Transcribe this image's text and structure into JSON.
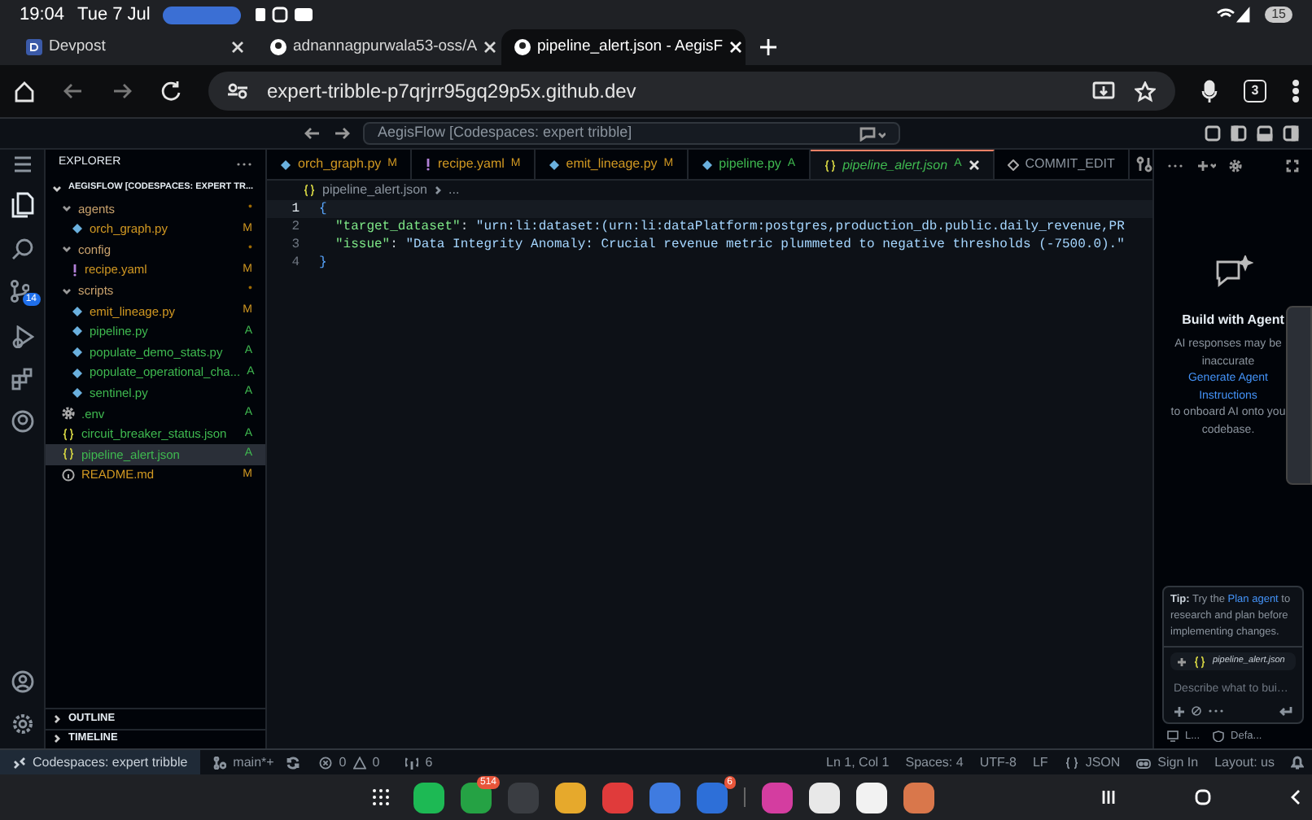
{
  "system_bar": {
    "time": "19:04",
    "date": "Tue 7 Jul",
    "battery": "15"
  },
  "browser_tabs": [
    {
      "title": "Devpost",
      "selected": false,
      "kind": "devpost"
    },
    {
      "title": "adnannagpurwala53-oss/A",
      "selected": false,
      "kind": "github"
    },
    {
      "title": "pipeline_alert.json - AegisF",
      "selected": true,
      "kind": "github"
    }
  ],
  "address_bar": {
    "url": "expert-tribble-p7qrjrr95gq29p5x.github.dev",
    "tab_count": "3"
  },
  "title_bar": {
    "command_center": "AegisFlow [Codespaces: expert tribble]"
  },
  "activity_bar": {
    "source_control_badge": "14"
  },
  "explorer": {
    "title": "EXPLORER",
    "root": "AEGISFLOW [CODESPACES: EXPERT TR...",
    "items": [
      {
        "kind": "folder",
        "name": "agents",
        "status": "•",
        "expanded": true,
        "selected": false,
        "children": [
          {
            "kind": "python",
            "name": "orch_graph.py",
            "status": "M",
            "selected": false
          }
        ]
      },
      {
        "kind": "folder",
        "name": "config",
        "status": "•",
        "expanded": true,
        "selected": false,
        "children": [
          {
            "kind": "yaml",
            "name": "recipe.yaml",
            "status": "M",
            "selected": false
          }
        ]
      },
      {
        "kind": "folder",
        "name": "scripts",
        "status": "•",
        "expanded": true,
        "selected": false,
        "children": [
          {
            "kind": "python",
            "name": "emit_lineage.py",
            "status": "M",
            "selected": false
          },
          {
            "kind": "python",
            "name": "pipeline.py",
            "status": "A",
            "selected": false
          },
          {
            "kind": "python",
            "name": "populate_demo_stats.py",
            "status": "A",
            "selected": false
          },
          {
            "kind": "python",
            "name": "populate_operational_cha...",
            "status": "A",
            "selected": false
          },
          {
            "kind": "python",
            "name": "sentinel.py",
            "status": "A",
            "selected": false
          }
        ]
      },
      {
        "kind": "env",
        "name": ".env",
        "status": "A",
        "selected": false
      },
      {
        "kind": "json",
        "name": "circuit_breaker_status.json",
        "status": "A",
        "selected": false
      },
      {
        "kind": "json",
        "name": "pipeline_alert.json",
        "status": "A",
        "selected": true
      },
      {
        "kind": "readme",
        "name": "README.md",
        "status": "M",
        "selected": false
      }
    ],
    "sections": [
      {
        "title": "OUTLINE",
        "expanded": false
      },
      {
        "title": "TIMELINE",
        "expanded": false
      }
    ]
  },
  "editor_tabs": [
    {
      "kind": "python",
      "name": "orch_graph.py",
      "status": "M",
      "selected": false
    },
    {
      "kind": "yaml",
      "name": "recipe.yaml",
      "status": "M",
      "selected": false
    },
    {
      "kind": "python",
      "name": "emit_lineage.py",
      "status": "M",
      "selected": false
    },
    {
      "kind": "python",
      "name": "pipeline.py",
      "status": "A",
      "selected": false
    },
    {
      "kind": "json",
      "name": "pipeline_alert.json",
      "status": "A",
      "selected": true
    },
    {
      "kind": "commit",
      "name": "COMMIT_EDIT",
      "selected": false
    }
  ],
  "breadcrumb": {
    "file": "pipeline_alert.json",
    "more": "..."
  },
  "code_lines": [
    {
      "number": "1",
      "text": "{",
      "current": true
    },
    {
      "number": "2",
      "key": "\"target_dataset\"",
      "colon": ":",
      "value": "\"urn:li:dataset:(urn:li:dataPlatform:postgres,production_db.public.daily_revenue,PR",
      "current": false
    },
    {
      "number": "3",
      "key": "\"issue\"",
      "colon": ":",
      "value": "\"Data Integrity Anomaly: Crucial revenue metric plummeted to negative thresholds (-7500.0).\"",
      "current": false
    },
    {
      "number": "4",
      "text": "}",
      "current": false
    }
  ],
  "chat": {
    "heading": "Build with Agent",
    "note": "AI responses may be inaccurate",
    "link": "Generate Agent Instructions",
    "note_end": "to onboard AI onto you",
    "note_tail": "codebase.",
    "tip_label": "Tip:",
    "tip_start": "Try the",
    "tip_link": "Plan agent",
    "tip_end": "to research and plan before implementing changes.",
    "context_file": "pipeline_alert.json",
    "placeholder": "Describe what to bui…",
    "footer": [
      "L...",
      "Defa..."
    ]
  },
  "status_bar": {
    "remote": "Codespaces: expert tribble",
    "branch": "main*+",
    "errors": "0",
    "warnings": "0",
    "ports": "6",
    "position": "Ln 1, Col 1",
    "spaces": "Spaces: 4",
    "encoding": "UTF-8",
    "eol": "LF",
    "language": "JSON",
    "sign_in": "Sign In",
    "layout": "Layout: us"
  },
  "dock": {
    "apps": [
      {
        "kind": "phone"
      },
      {
        "kind": "whatsapp",
        "badge": "514"
      },
      {
        "kind": "settings"
      },
      {
        "kind": "files"
      },
      {
        "kind": "notes"
      },
      {
        "kind": "messages"
      },
      {
        "kind": "chat",
        "badge": "6"
      },
      {
        "kind": "gallery"
      },
      {
        "kind": "chrome"
      },
      {
        "kind": "gemini"
      },
      {
        "kind": "claude"
      }
    ]
  }
}
